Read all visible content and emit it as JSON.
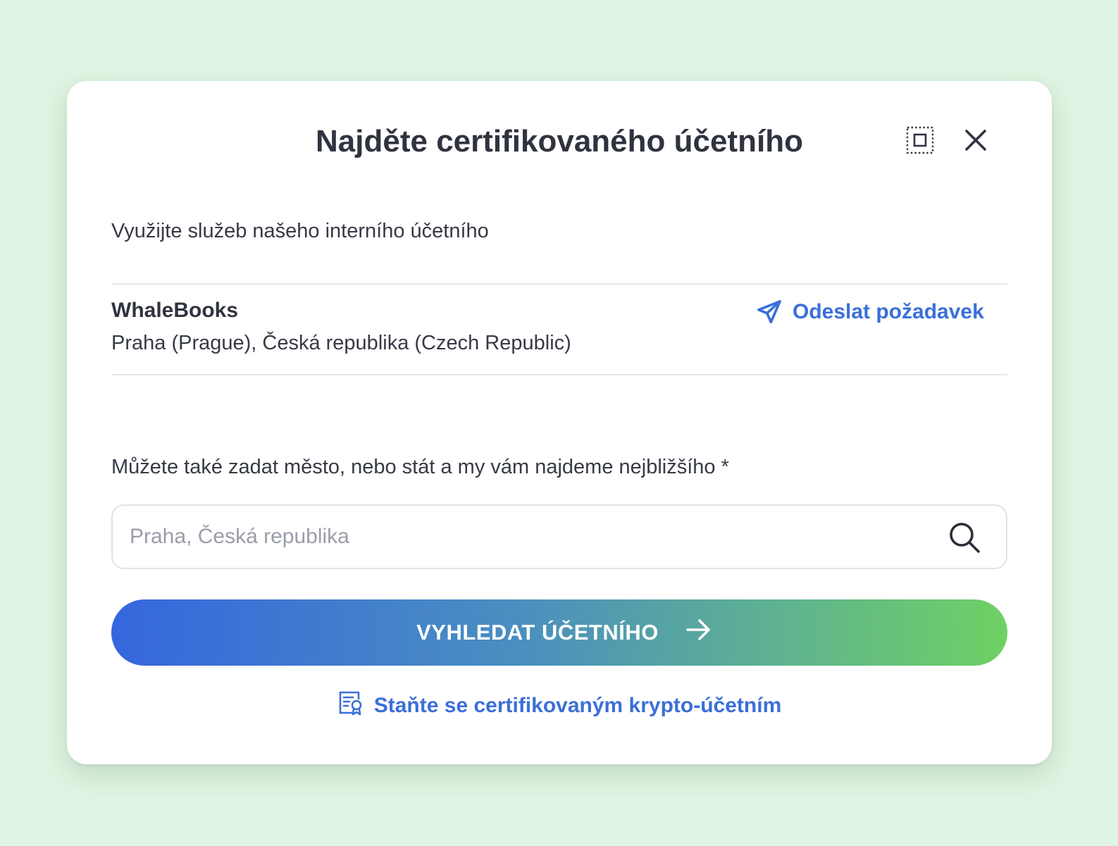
{
  "modal": {
    "title": "Najděte certifikovaného účetního",
    "expand_icon": "expand-frame-icon",
    "close_icon": "close-icon"
  },
  "internal": {
    "intro_text": "Využijte služeb našeho interního účetního",
    "accountant_name": "WhaleBooks",
    "accountant_location": "Praha (Prague), Česká republika (Czech Republic)",
    "send_request_label": "Odeslat požadavek",
    "send_request_icon": "paper-plane-icon"
  },
  "search": {
    "label": "Můžete také zadat město, nebo stát a my vám najdeme nejbližšího *",
    "placeholder": "Praha, Česká republika",
    "value": "",
    "icon": "search-icon"
  },
  "cta": {
    "label": "VYHLEDAT ÚČETNÍHO",
    "icon": "arrow-right-icon",
    "gradient_start": "#3566de",
    "gradient_end": "#6fd163"
  },
  "footer": {
    "cert_link_label": "Staňte se certifikovaným krypto-účetním",
    "cert_link_icon": "certificate-icon"
  },
  "colors": {
    "background": "#e0f5e3",
    "link": "#3b6fd9",
    "text": "#30333f"
  }
}
